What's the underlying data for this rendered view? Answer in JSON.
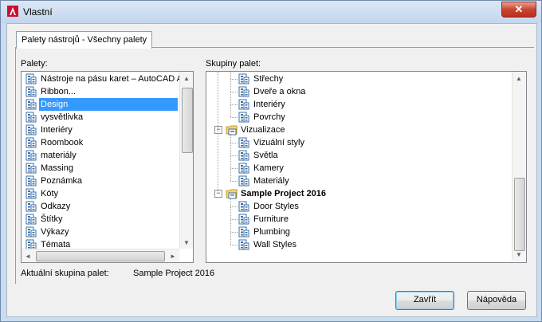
{
  "window": {
    "title": "Vlastní",
    "close_label": "✕"
  },
  "tab": {
    "label": "Palety nástrojů - Všechny palety"
  },
  "palettes": {
    "label": "Palety:",
    "selected_index": 2,
    "items": [
      "Nástroje na pásu karet – AutoCAD Ar",
      "Ribbon...",
      "Design",
      "vysvětlivka",
      "Interiéry",
      "Roombook",
      "materiály",
      "Massing",
      "Poznámka",
      "Kóty",
      "Odkazy",
      "Štítky",
      "Výkazy",
      "Témata"
    ],
    "hscroll_left": "◄",
    "hscroll_right": "►"
  },
  "groups": {
    "label": "Skupiny palet:",
    "items": [
      {
        "text": "Střechy",
        "type": "palette",
        "level": 2
      },
      {
        "text": "Dveře a okna",
        "type": "palette",
        "level": 2
      },
      {
        "text": "Interiéry",
        "type": "palette",
        "level": 2
      },
      {
        "text": "Povrchy",
        "type": "palette",
        "level": 2
      },
      {
        "text": "Vizualizace",
        "type": "folder",
        "level": 1,
        "expander": "−"
      },
      {
        "text": "Vizuální styly",
        "type": "palette",
        "level": 2
      },
      {
        "text": "Světla",
        "type": "palette",
        "level": 2
      },
      {
        "text": "Kamery",
        "type": "palette",
        "level": 2
      },
      {
        "text": "Materiály",
        "type": "palette",
        "level": 2
      },
      {
        "text": "Sample Project 2016",
        "type": "folder",
        "level": 1,
        "bold": true,
        "expander": "−"
      },
      {
        "text": "Door Styles",
        "type": "palette",
        "level": 2
      },
      {
        "text": "Furniture",
        "type": "palette",
        "level": 2
      },
      {
        "text": "Plumbing",
        "type": "palette",
        "level": 2
      },
      {
        "text": "Wall Styles",
        "type": "palette",
        "level": 2
      }
    ]
  },
  "current_group": {
    "label": "Aktuální skupina palet:",
    "value": "Sample Project 2016"
  },
  "buttons": {
    "close": "Zavřít",
    "help": "Nápověda"
  },
  "scroll": {
    "up": "▲",
    "down": "▼"
  }
}
